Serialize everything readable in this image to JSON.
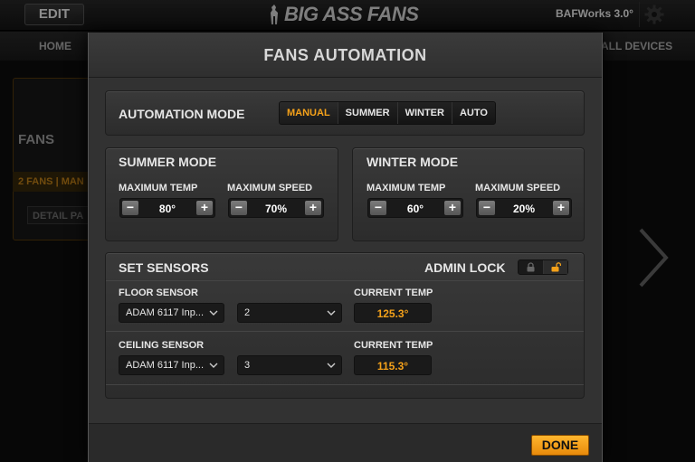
{
  "app": {
    "edit_label": "EDIT",
    "brand": "BIG ASS FANS",
    "device_name": "BAFWorks 3.0°",
    "nav_home": "HOME",
    "nav_all_devices": "ALL DEVICES",
    "fans_heading": "FANS",
    "fans_strip": "2 FANS | MAN",
    "detail_button": "DETAIL PA",
    "accent_color": "#f4a11a"
  },
  "modal": {
    "title": "FANS AUTOMATION",
    "automation_mode": {
      "label": "AUTOMATION MODE",
      "options": [
        "MANUAL",
        "SUMMER",
        "WINTER",
        "AUTO"
      ],
      "selected": "MANUAL"
    },
    "summer": {
      "title": "SUMMER MODE",
      "max_temp_label": "MAXIMUM TEMP",
      "max_temp": "80°",
      "max_speed_label": "MAXIMUM SPEED",
      "max_speed": "70%"
    },
    "winter": {
      "title": "WINTER MODE",
      "max_temp_label": "MAXIMUM TEMP",
      "max_temp": "60°",
      "max_speed_label": "MAXIMUM SPEED",
      "max_speed": "20%"
    },
    "sensors": {
      "title": "SET SENSORS",
      "admin_lock_label": "ADMIN LOCK",
      "admin_lock_state": "unlocked",
      "floor": {
        "label": "FLOOR SENSOR",
        "device": "ADAM 6117 Inp...",
        "channel": "2",
        "current_temp_label": "CURRENT TEMP",
        "current_temp": "125.3°"
      },
      "ceiling": {
        "label": "CEILING SENSOR",
        "device": "ADAM 6117 Inp...",
        "channel": "3",
        "current_temp_label": "CURRENT TEMP",
        "current_temp": "115.3°"
      }
    },
    "done_label": "DONE",
    "stepper_minus": "−",
    "stepper_plus": "+"
  }
}
